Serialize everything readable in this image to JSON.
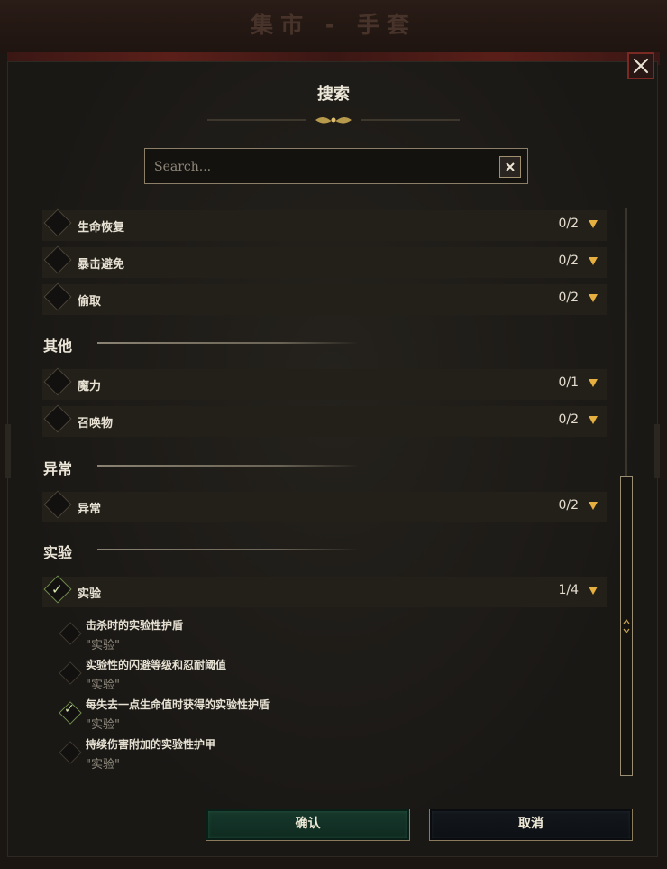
{
  "background": {
    "title": "集市 - 手套"
  },
  "dialog": {
    "title": "搜索",
    "search": {
      "placeholder": "Search...",
      "value": ""
    },
    "rows_top": [
      {
        "label": "生命恢复",
        "count": "0/2"
      },
      {
        "label": "暴击避免",
        "count": "0/2"
      },
      {
        "label": "偷取",
        "count": "0/2"
      }
    ],
    "sections": [
      {
        "title": "其他",
        "rows": [
          {
            "label": "魔力",
            "count": "0/1"
          },
          {
            "label": "召唤物",
            "count": "0/2"
          }
        ]
      },
      {
        "title": "异常",
        "rows": [
          {
            "label": "异常",
            "count": "0/2"
          }
        ]
      },
      {
        "title": "实验",
        "rows": [
          {
            "label": "实验",
            "count": "1/4",
            "checked": true
          }
        ]
      }
    ],
    "subitems": [
      {
        "name": "击杀时的实验性护盾",
        "tag": "\"实验\"",
        "checked": false
      },
      {
        "name": "实验性的闪避等级和忍耐阈值",
        "tag": "\"实验\"",
        "checked": false
      },
      {
        "name": "每失去一点生命值时获得的实验性护盾",
        "tag": "\"实验\"",
        "checked": true
      },
      {
        "name": "持续伤害附加的实验性护甲",
        "tag": "\"实验\"",
        "checked": false
      }
    ],
    "buttons": {
      "confirm": "确认",
      "cancel": "取消"
    }
  },
  "colors": {
    "accent_gold": "#e6b040",
    "confirm_green": "#17382c",
    "close_red": "#7a2a23"
  }
}
